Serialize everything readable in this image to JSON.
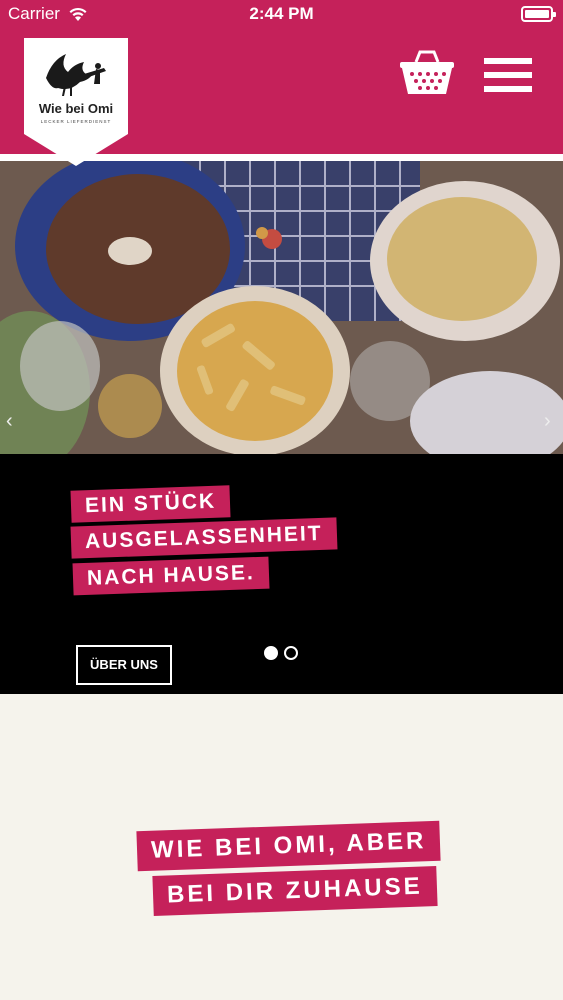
{
  "status_bar": {
    "carrier": "Carrier",
    "time": "2:44 PM",
    "wifi_icon": "wifi-icon",
    "battery_icon": "battery-icon"
  },
  "header": {
    "logo": {
      "title": "Wie bei Omi",
      "subtitle": "LECKER LIEFERDIENST",
      "icon": "stork-icon"
    },
    "cart_icon": "basket-icon",
    "menu_icon": "hamburger-menu-icon",
    "brand_color": "#c5215a"
  },
  "hero": {
    "image_description_icon": "food-table-photo",
    "prev_arrow": "‹",
    "next_arrow": "›"
  },
  "slide": {
    "headline_lines": [
      "EIN STÜCK",
      "AUSGELASSENHEIT",
      "NACH HAUSE."
    ],
    "button_label": "ÜBER UNS",
    "pagination": {
      "total": 2,
      "active": 1
    }
  },
  "intro": {
    "tag_lines": [
      "WIE BEI OMI, ABER",
      "BEI DIR ZUHAUSE"
    ]
  }
}
